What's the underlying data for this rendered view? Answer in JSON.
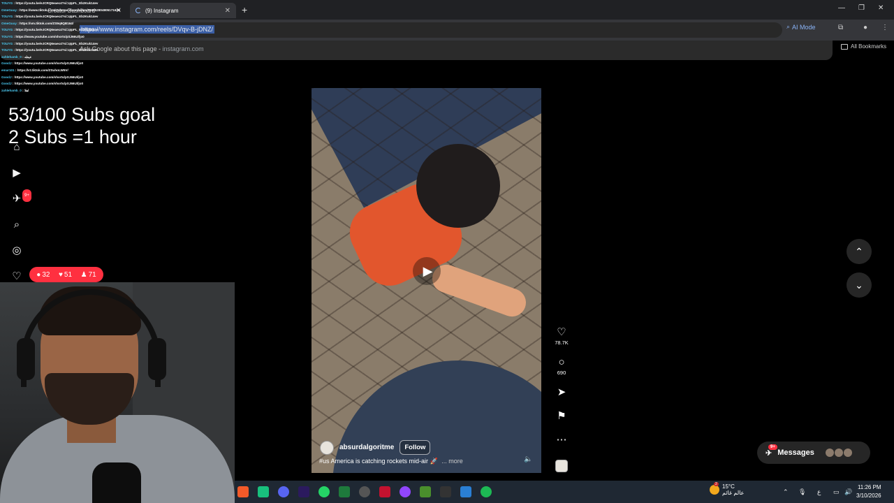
{
  "browser": {
    "tabs": [
      {
        "title": "Creator Dashboard"
      },
      {
        "title": "(9) Instagram"
      }
    ],
    "url": "https://www.instagram.com/reels/DVqv-B-jDNZ/",
    "ai_mode_label": "AI Mode",
    "suggestion_text": "Ask Google about this page",
    "suggestion_separator": " - ",
    "suggestion_domain": "instagram.com",
    "bookmarks_label": "All Bookmarks"
  },
  "stream_overlay": {
    "chat": [
      {
        "user": "TOUYG",
        "text": "https://youtu.be/eJCRQ6eaec4?si=qIpFL_Eb2Kuk14ev"
      },
      {
        "user": "OmeGuuy",
        "text": "https://www.tiktok.com/@demar.dixon/video/7548528048051716360"
      },
      {
        "user": "TOUYG",
        "text": "https://youtu.be/eJCRQ6eaec4?si=qIpFL_Eb2Kuk14ev"
      },
      {
        "user": "OmeGuuy",
        "text": "https://vm.tiktok.com/ZS9q9QB164/"
      },
      {
        "user": "TOUYG",
        "text": "https://youtu.be/eJCRQ6eaec4?si=qIpFL_Eb2Kuk14ev"
      },
      {
        "user": "TOUYG",
        "text": "https://www.youtube.com/shorts/pSJ66Ul/jo0"
      },
      {
        "user": "TOUYG",
        "text": "https://youtu.be/eJCRQ6eaec4?si=qIpFL_Eb2Kuk14ev"
      },
      {
        "user": "TOUYG",
        "text": "https://youtu.be/eJCRQ6eaec4?si=qIpFL_Eb2Kuk14ev"
      },
      {
        "user": "zahlehamb_0",
        "text": "عيطه"
      },
      {
        "user": "GoodJ",
        "text": "https://www.youtube.com/shorts/pSJ66Ul/jo0"
      },
      {
        "user": "emar101",
        "text": "https://vt.tiktok.com/ZSuhoLW5V/"
      },
      {
        "user": "GoodJ",
        "text": "https://www.youtube.com/shorts/pSJ66Ul/jo0"
      },
      {
        "user": "GoodJ",
        "text": "https://www.youtube.com/shorts/pSJ66Ul/jo0"
      },
      {
        "user": "zahlehamb_0",
        "text": "اهلا"
      }
    ],
    "goal_line1": "53/100 Subs goal",
    "goal_line2": "2 Subs =1 hour",
    "nav_badge": "9+",
    "activity": {
      "comments": "32",
      "likes": "51",
      "followers": "71"
    }
  },
  "reel": {
    "username": "absurdalgoritme",
    "follow_label": "Follow",
    "caption": "#us America is catching rockets mid-air 🚀",
    "more_label": "... more",
    "likes": "78.7K",
    "comments": "690"
  },
  "messages": {
    "label": "Messages",
    "badge": "9+"
  },
  "taskbar": {
    "temperature": "15°C",
    "weather_label": "عالم غائم",
    "time": "11:26 PM",
    "date": "3/10/2026",
    "weather_badge": "2",
    "input_lang": "ع"
  },
  "colors": {
    "accent": "#ff3040",
    "link": "#8ab4f8"
  }
}
